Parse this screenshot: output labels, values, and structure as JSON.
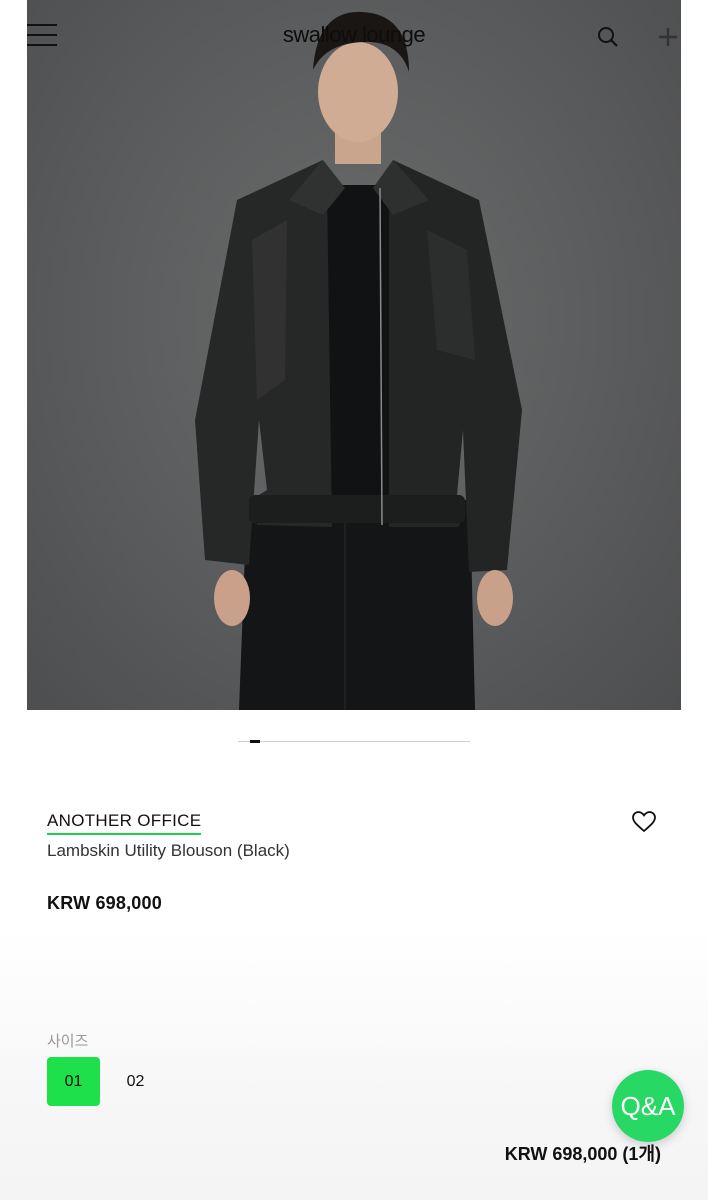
{
  "header": {
    "logo": "swallow lounge",
    "menu_icon": "hamburger-menu-icon",
    "search_icon": "search-icon",
    "add_icon": "plus-icon"
  },
  "gallery": {
    "image_description_icon": "product-photo",
    "page_indicator_active": 1
  },
  "product": {
    "brand": "ANOTHER OFFICE",
    "name": "Lambskin Utility Blouson (Black)",
    "price": "KRW 698,000",
    "wishlist_icon": "heart-icon"
  },
  "options": {
    "size_label": "사이즈",
    "sizes": [
      {
        "label": "01",
        "selected": true
      },
      {
        "label": "02",
        "selected": false
      }
    ]
  },
  "qa_button": {
    "label": "Q&A"
  },
  "summary": {
    "total": "KRW 698,000 (1개)"
  },
  "colors": {
    "accent_green": "#1ee04a",
    "brand_underline": "#22d04a",
    "qa_green": "#27d864"
  }
}
